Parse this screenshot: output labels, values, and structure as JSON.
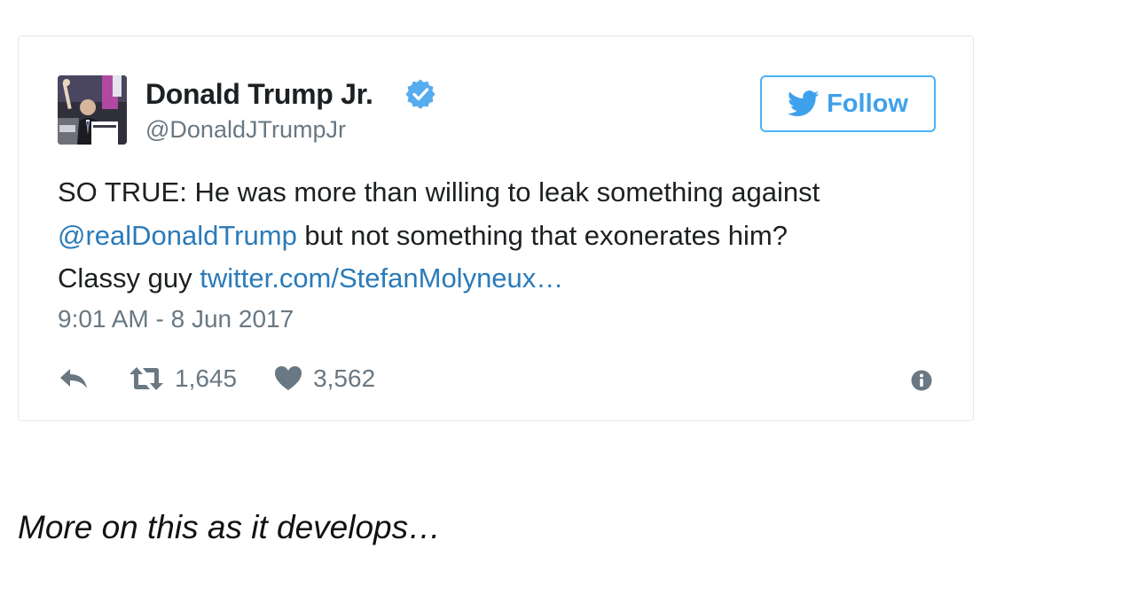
{
  "tweet": {
    "author": {
      "display_name": "Donald Trump Jr.",
      "handle": "@DonaldJTrumpJr",
      "verified": true,
      "avatar_icon": "profile-photo"
    },
    "follow_button": {
      "label": "Follow",
      "icon": "twitter-bird-icon",
      "color": "#3ea1ec"
    },
    "text": {
      "part1": "SO TRUE: He was more than willing to leak something against",
      "mention": "@realDonaldTrump",
      "part2": " but not something that exonerates him?",
      "part3": "Classy guy ",
      "link": "twitter.com/StefanMolyneux…"
    },
    "timestamp": "9:01 AM - 8 Jun 2017",
    "actions": {
      "reply_icon": "reply-icon",
      "retweet_icon": "retweet-icon",
      "retweet_count": "1,645",
      "like_icon": "heart-icon",
      "like_count": "3,562",
      "info_icon": "info-icon"
    },
    "colors": {
      "link": "#2b7bb9",
      "muted": "#697882",
      "verified": "#55acee",
      "border": "#e1e8ed"
    }
  },
  "article": {
    "footer_text": "More on this as it develops…"
  }
}
